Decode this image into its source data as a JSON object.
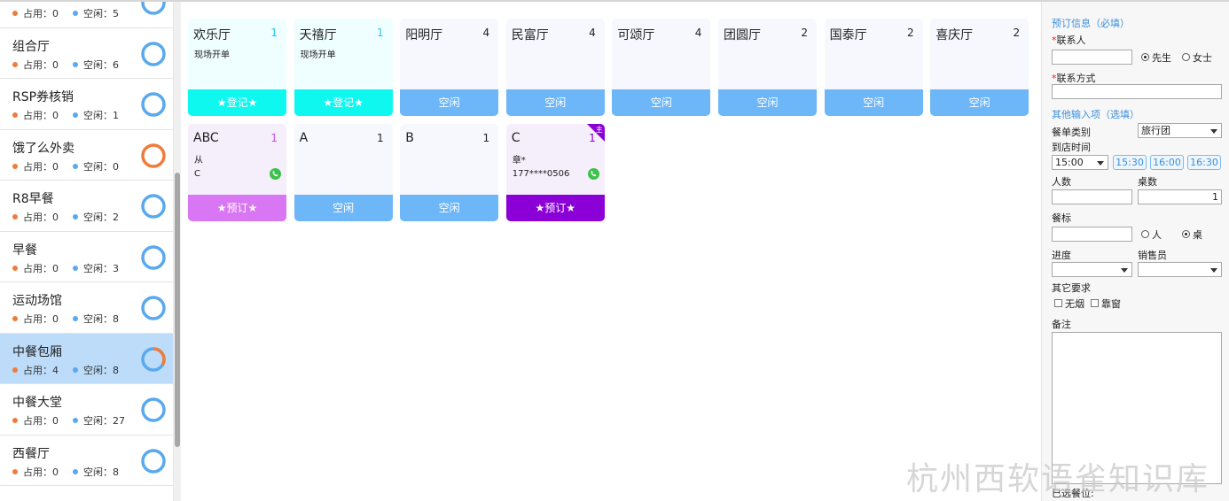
{
  "areas": [
    {
      "name": "",
      "occupied_label": "占用：0",
      "free_label": "空闲：5",
      "occupied": 0,
      "free": 5
    },
    {
      "name": "组合厅",
      "occupied_label": "占用：0",
      "free_label": "空闲：6",
      "occupied": 0,
      "free": 6
    },
    {
      "name": "RSP券核销",
      "occupied_label": "占用：0",
      "free_label": "空闲：1",
      "occupied": 0,
      "free": 1
    },
    {
      "name": "饿了么外卖",
      "occupied_label": "占用：0",
      "free_label": "空闲：0",
      "occupied": 0,
      "free": 0
    },
    {
      "name": "R8早餐",
      "occupied_label": "占用：0",
      "free_label": "空闲：2",
      "occupied": 0,
      "free": 2
    },
    {
      "name": "早餐",
      "occupied_label": "占用：0",
      "free_label": "空闲：3",
      "occupied": 0,
      "free": 3
    },
    {
      "name": "运动场馆",
      "occupied_label": "占用：0",
      "free_label": "空闲：8",
      "occupied": 0,
      "free": 8
    },
    {
      "name": "中餐包厢",
      "occupied_label": "占用：4",
      "free_label": "空闲：8",
      "occupied": 4,
      "free": 8,
      "active": true
    },
    {
      "name": "中餐大堂",
      "occupied_label": "占用：0",
      "free_label": "空闲：27",
      "occupied": 0,
      "free": 27
    },
    {
      "name": "西餐厅",
      "occupied_label": "占用：0",
      "free_label": "空闲：8",
      "occupied": 0,
      "free": 8
    }
  ],
  "rooms": [
    {
      "name": "欢乐厅",
      "count": "1",
      "line1": "现场开单",
      "line2": "",
      "status": "★登记★",
      "state": "registered",
      "phone": false
    },
    {
      "name": "天禧厅",
      "count": "1",
      "line1": "现场开单",
      "line2": "",
      "status": "★登记★",
      "state": "registered",
      "phone": false
    },
    {
      "name": "阳明厅",
      "count": "4",
      "line1": "",
      "line2": "",
      "status": "空闲",
      "state": "idle",
      "phone": false
    },
    {
      "name": "民富厅",
      "count": "4",
      "line1": "",
      "line2": "",
      "status": "空闲",
      "state": "idle",
      "phone": false
    },
    {
      "name": "可颂厅",
      "count": "4",
      "line1": "",
      "line2": "",
      "status": "空闲",
      "state": "idle",
      "phone": false
    },
    {
      "name": "团圆厅",
      "count": "2",
      "line1": "",
      "line2": "",
      "status": "空闲",
      "state": "idle",
      "phone": false
    },
    {
      "name": "国泰厅",
      "count": "2",
      "line1": "",
      "line2": "",
      "status": "空闲",
      "state": "idle",
      "phone": false
    },
    {
      "name": "喜庆厅",
      "count": "2",
      "line1": "",
      "line2": "",
      "status": "空闲",
      "state": "idle",
      "phone": false
    },
    {
      "name": "ABC",
      "count": "1",
      "line1": "从",
      "line2": "C",
      "status": "★预订★",
      "state": "reserved",
      "phone": true
    },
    {
      "name": "A",
      "count": "1",
      "line1": "",
      "line2": "",
      "status": "空闲",
      "state": "idle",
      "phone": false
    },
    {
      "name": "B",
      "count": "1",
      "line1": "",
      "line2": "",
      "status": "空闲",
      "state": "idle",
      "phone": false
    },
    {
      "name": "C",
      "count": "1",
      "line1": "章*",
      "line2": "177****0506",
      "status": "★预订★",
      "state": "reserved_main",
      "phone": true,
      "corner": "主"
    }
  ],
  "form": {
    "section_required": "预订信息（必填）",
    "contact_label": "联系人",
    "contact_value": "",
    "gender_male": "先生",
    "gender_female": "女士",
    "phone_label": "联系方式",
    "phone_value": "",
    "section_optional": "其他输入项（选填）",
    "meal_type_label": "餐单类别",
    "meal_type_value": "旅行团",
    "arrival_label": "到店时间",
    "arrival_value": "15:00",
    "quick_times": [
      "15:30",
      "16:00",
      "16:30"
    ],
    "people_label": "人数",
    "people_value": "",
    "tables_label": "桌数",
    "tables_value": "1",
    "standard_label": "餐标",
    "standard_value": "",
    "per_person": "人",
    "per_table": "桌",
    "progress_label": "进度",
    "progress_value": "",
    "sales_label": "销售员",
    "sales_value": "",
    "other_label": "其它要求",
    "no_smoking": "无烟",
    "by_window": "靠窗",
    "remark_label": "备注",
    "selected_label": "已选餐位:"
  },
  "watermark": "杭州西软语雀知识库",
  "colors": {
    "occupied": "#ee7d3b",
    "free": "#5aa9ee",
    "idle_bar": "#6db6f8",
    "registered_bar": "#0ff8f0",
    "reserved_bar": "#d976f3",
    "reserved_main_bar": "#8b00d6",
    "section_title": "#3d8fdd"
  }
}
